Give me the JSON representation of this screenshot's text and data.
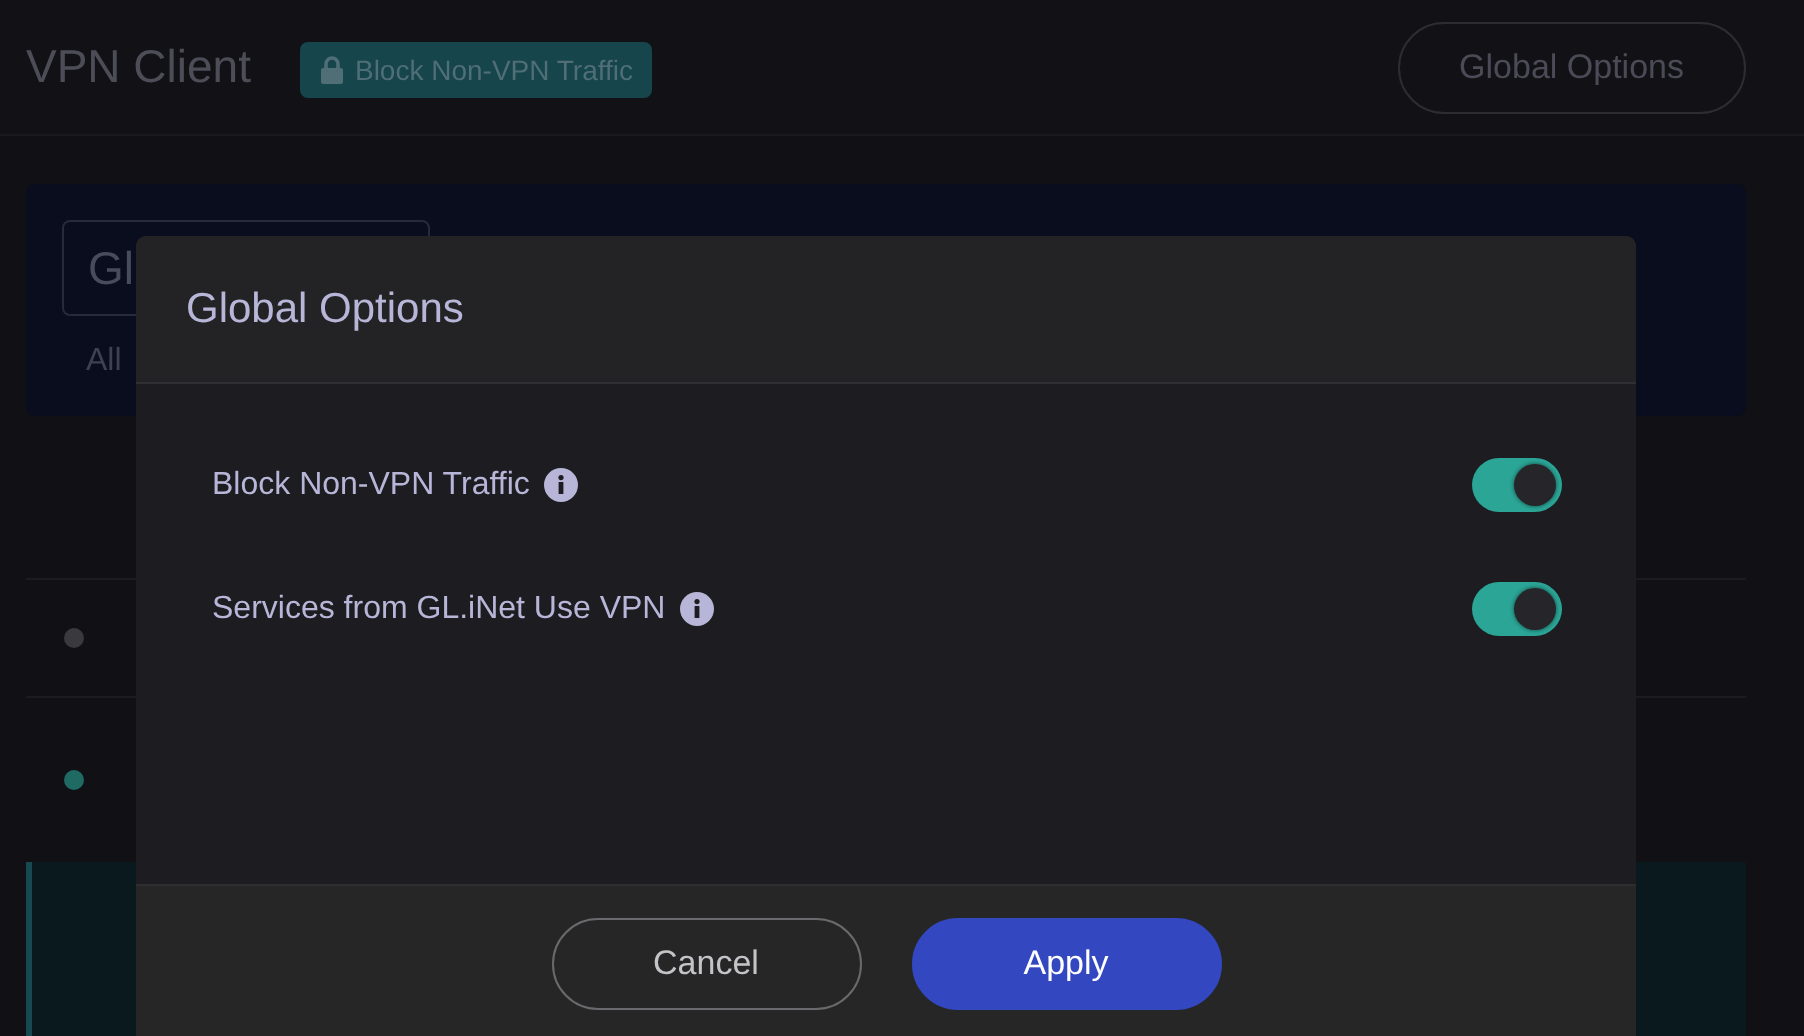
{
  "page": {
    "title": "VPN Client",
    "badge": "Block Non-VPN Traffic",
    "global_options_button": "Global Options"
  },
  "panel": {
    "field_value": "Gl",
    "caption": "All"
  },
  "table": {
    "rows": [
      {
        "color": "#3a3a3e"
      },
      {
        "color": "#1f6b63"
      }
    ]
  },
  "dialog": {
    "title": "Global Options",
    "options": [
      {
        "label": "Block Non-VPN Traffic",
        "on": true
      },
      {
        "label": "Services from GL.iNet Use VPN",
        "on": true
      }
    ],
    "buttons": [
      {
        "label": "Cancel",
        "kind": "secondary"
      },
      {
        "label": "Apply",
        "kind": "primary"
      }
    ]
  }
}
